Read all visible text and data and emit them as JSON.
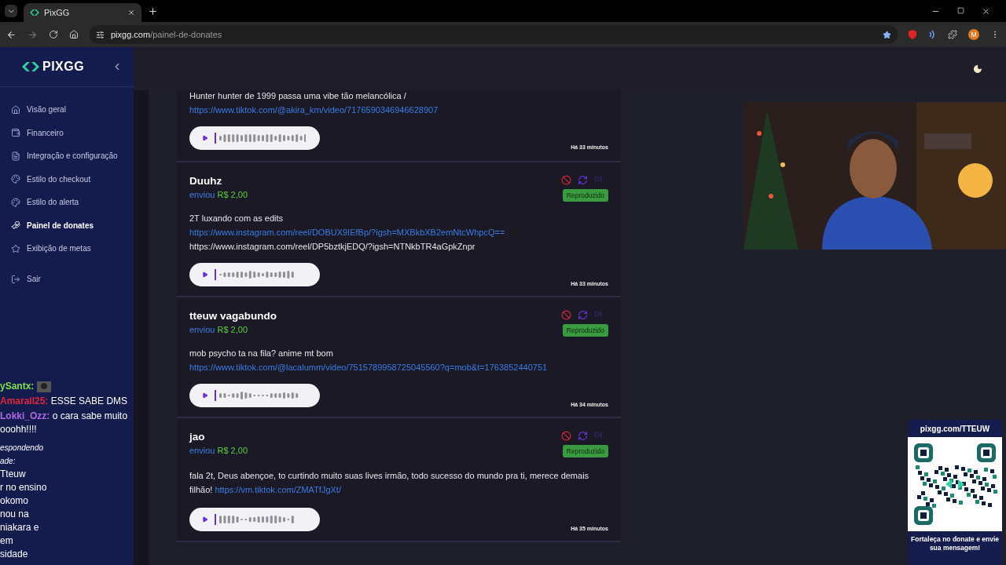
{
  "browser": {
    "tab": {
      "title": "PixGG",
      "selected": true
    },
    "url_host": "pixgg.com",
    "url_path": "/painel-de-donates",
    "profile": "M"
  },
  "sidebar": {
    "logo": "PIXGG",
    "items": [
      {
        "label": "Visão geral",
        "selected": false
      },
      {
        "label": "Financeiro",
        "selected": false
      },
      {
        "label": "Integração e configuração",
        "selected": false
      },
      {
        "label": "Estilo do checkout",
        "selected": false
      },
      {
        "label": "Estilo do alerta",
        "selected": false
      },
      {
        "label": "Painel de donates",
        "selected": true
      },
      {
        "label": "Exibição de metas",
        "selected": false
      },
      {
        "label": "Sair",
        "selected": false
      }
    ]
  },
  "donations": [
    {
      "partial": true,
      "message": [
        [
          {
            "text": "Hunter hunter de 1999 passa uma vibe tão melancólica /",
            "link": false
          }
        ],
        [
          {
            "text": "https://www.tiktok.com/@akira_km/video/7176590346946628907",
            "link": true
          }
        ]
      ],
      "time": "Há 33 minutos"
    },
    {
      "partial": false,
      "name": "Duuhz",
      "sent": "enviou",
      "amount": "R$ 2,00",
      "status": "Reproduzido",
      "message": [
        [
          {
            "text": "2T luxando com as edits",
            "link": false
          }
        ],
        [
          {
            "text": "https://www.instagram.com/reel/DOBUX9IEfBp/?igsh=MXBkbXB2emNtcWhpcQ==",
            "link": true
          }
        ],
        [
          {
            "text": "https://www.instagram.com/reel/DP5bztkjEDQ/?igsh=NTNkbTR4aGpkZnpr",
            "link": false
          }
        ]
      ],
      "time": "Há 33 minutos"
    },
    {
      "partial": false,
      "name": "tteuw vagabundo",
      "sent": "enviou",
      "amount": "R$ 2,00",
      "status": "Reproduzido",
      "message": [
        [
          {
            "text": "mob psycho ta na fila? anime mt bom",
            "link": false
          }
        ],
        [
          {
            "text": "https://www.tiktok.com/@lacalumm/video/7515789958725045560?q=mob&t=1763852440751",
            "link": true
          }
        ]
      ],
      "time": "Há 34 minutos"
    },
    {
      "partial": false,
      "name": "jao",
      "sent": "enviou",
      "amount": "R$ 2,00",
      "status": "Reproduzido",
      "message": [
        [
          {
            "text": "fala 2t, Deus abençoe, to curtindo muito suas lives irmão, todo sucesso do mundo pra ti, merece demais filhão! ",
            "link": false
          },
          {
            "text": "https://vm.tiktok.com/ZMATfJgXt/",
            "link": true
          }
        ]
      ],
      "time": "Há 35 minutos"
    }
  ],
  "chat": [
    {
      "user": "ySantx:",
      "color": "#7fe04a",
      "kind": "emote"
    },
    {
      "user": "Amarall25:",
      "color": "#e0283c",
      "kind": "text",
      "text": "ESSE SABE DMS"
    },
    {
      "user": "Lokki_Ozz:",
      "color": "#b06ae8",
      "kind": "text",
      "text": "o cara sabe muito ooohh!!!!"
    },
    {
      "kind": "reply",
      "lines": [
        "espondendo",
        "ade:",
        "Tteuw",
        "r no ensino",
        "okomo",
        "nou na",
        "niakara e",
        "em",
        "sidade"
      ]
    }
  ],
  "qr": {
    "title": "pixgg.com/TTEUW",
    "caption": "Fortaleça no donate e envie sua mensagem!"
  }
}
